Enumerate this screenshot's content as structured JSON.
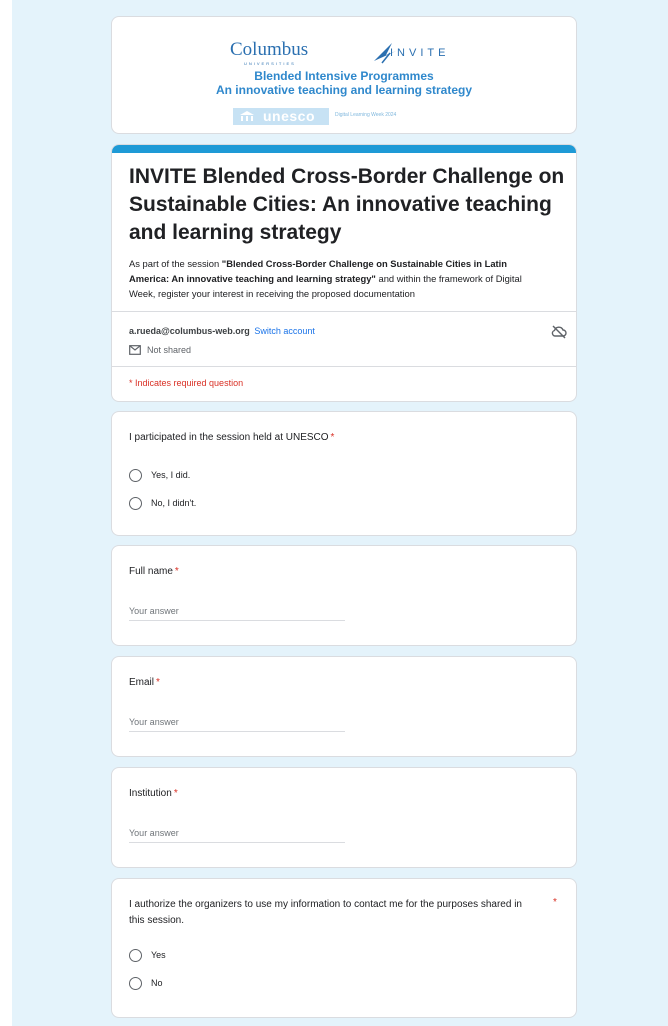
{
  "banner": {
    "columbus_logo": "Columbus",
    "columbus_sub": "UNIVERSITIES",
    "invite_logo": "INVITE",
    "line1": "Blended Intensive Programmes",
    "line2": "An innovative teaching and learning strategy",
    "unesco_logo": "unesco",
    "event_text": "Digital Learning Week 2024"
  },
  "form": {
    "title": "INVITE Blended Cross-Border Challenge on Sustainable Cities: An innovative teaching and learning strategy",
    "desc_pre": "As part of the session ",
    "desc_bold": "\"Blended Cross-Border Challenge on Sustainable Cities in Latin America: An innovative teaching and learning strategy\"",
    "desc_post": " and within the framework of Digital Week, register your interest in receiving the proposed documentation",
    "account_email": "a.rueda@columbus-web.org",
    "switch_account": "Switch account",
    "not_shared": "Not shared",
    "required_note": "* Indicates required question"
  },
  "questions": {
    "q1": {
      "title": "I participated in the session held at UNESCO",
      "req": "*",
      "options": [
        "Yes, I did.",
        "No, I didn't."
      ]
    },
    "q2": {
      "title": "Full name",
      "req": "*",
      "placeholder": "Your answer"
    },
    "q3": {
      "title": "Email",
      "req": "*",
      "placeholder": "Your answer"
    },
    "q4": {
      "title": "Institution",
      "req": "*",
      "placeholder": "Your answer"
    },
    "q5": {
      "title": "I authorize the organizers to use my information to contact me for the purposes shared in this session.",
      "req": "*",
      "options": [
        "Yes",
        "No"
      ]
    }
  },
  "colors": {
    "page_bg": "#e4f3fb",
    "accent": "#1e9ad6",
    "link": "#1a73e8",
    "required": "#d93025"
  },
  "icons": [
    "invite-bird-icon",
    "unesco-temple-icon",
    "cloud-off-icon",
    "not-shared-icon"
  ]
}
